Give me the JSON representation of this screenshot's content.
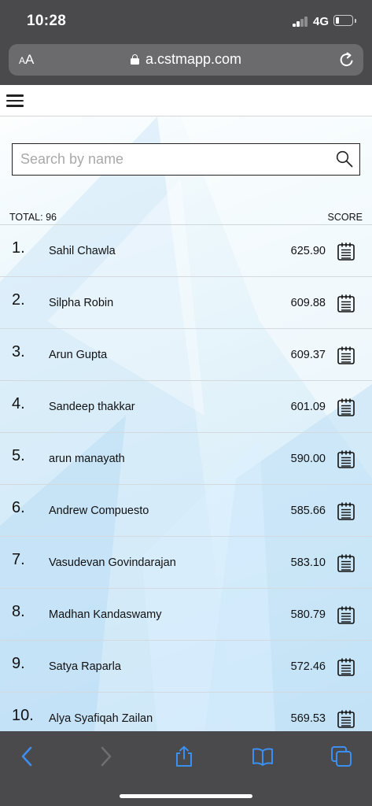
{
  "status_bar": {
    "time": "10:28",
    "network": "4G"
  },
  "browser": {
    "text_size_label_small": "A",
    "text_size_label_large": "A",
    "url": "a.cstmapp.com"
  },
  "search": {
    "placeholder": "Search by name",
    "value": ""
  },
  "list_header": {
    "total_label": "TOTAL: 96",
    "score_label": "SCORE"
  },
  "leaderboard": [
    {
      "rank": "1.",
      "name": "Sahil Chawla",
      "score": "625.90"
    },
    {
      "rank": "2.",
      "name": "Silpha Robin",
      "score": "609.88"
    },
    {
      "rank": "3.",
      "name": "Arun Gupta",
      "score": "609.37"
    },
    {
      "rank": "4.",
      "name": "Sandeep thakkar",
      "score": "601.09"
    },
    {
      "rank": "5.",
      "name": "arun manayath",
      "score": "590.00"
    },
    {
      "rank": "6.",
      "name": "Andrew Compuesto",
      "score": "585.66"
    },
    {
      "rank": "7.",
      "name": "Vasudevan Govindarajan",
      "score": "583.10"
    },
    {
      "rank": "8.",
      "name": "Madhan Kandaswamy",
      "score": "580.79"
    },
    {
      "rank": "9.",
      "name": "Satya Raparla",
      "score": "572.46"
    },
    {
      "rank": "10.",
      "name": "Alya Syafiqah Zailan",
      "score": "569.53"
    }
  ],
  "icons": {
    "menu": "hamburger-menu-icon",
    "search": "search-icon",
    "row_action": "report-list-icon",
    "toolbar": [
      "back-icon",
      "forward-icon",
      "share-icon",
      "bookmarks-icon",
      "tabs-icon"
    ]
  },
  "colors": {
    "browser_chrome": "#4a4a4c",
    "toolbar_accent": "#3b8ff0",
    "toolbar_disabled": "#6e6e72"
  }
}
